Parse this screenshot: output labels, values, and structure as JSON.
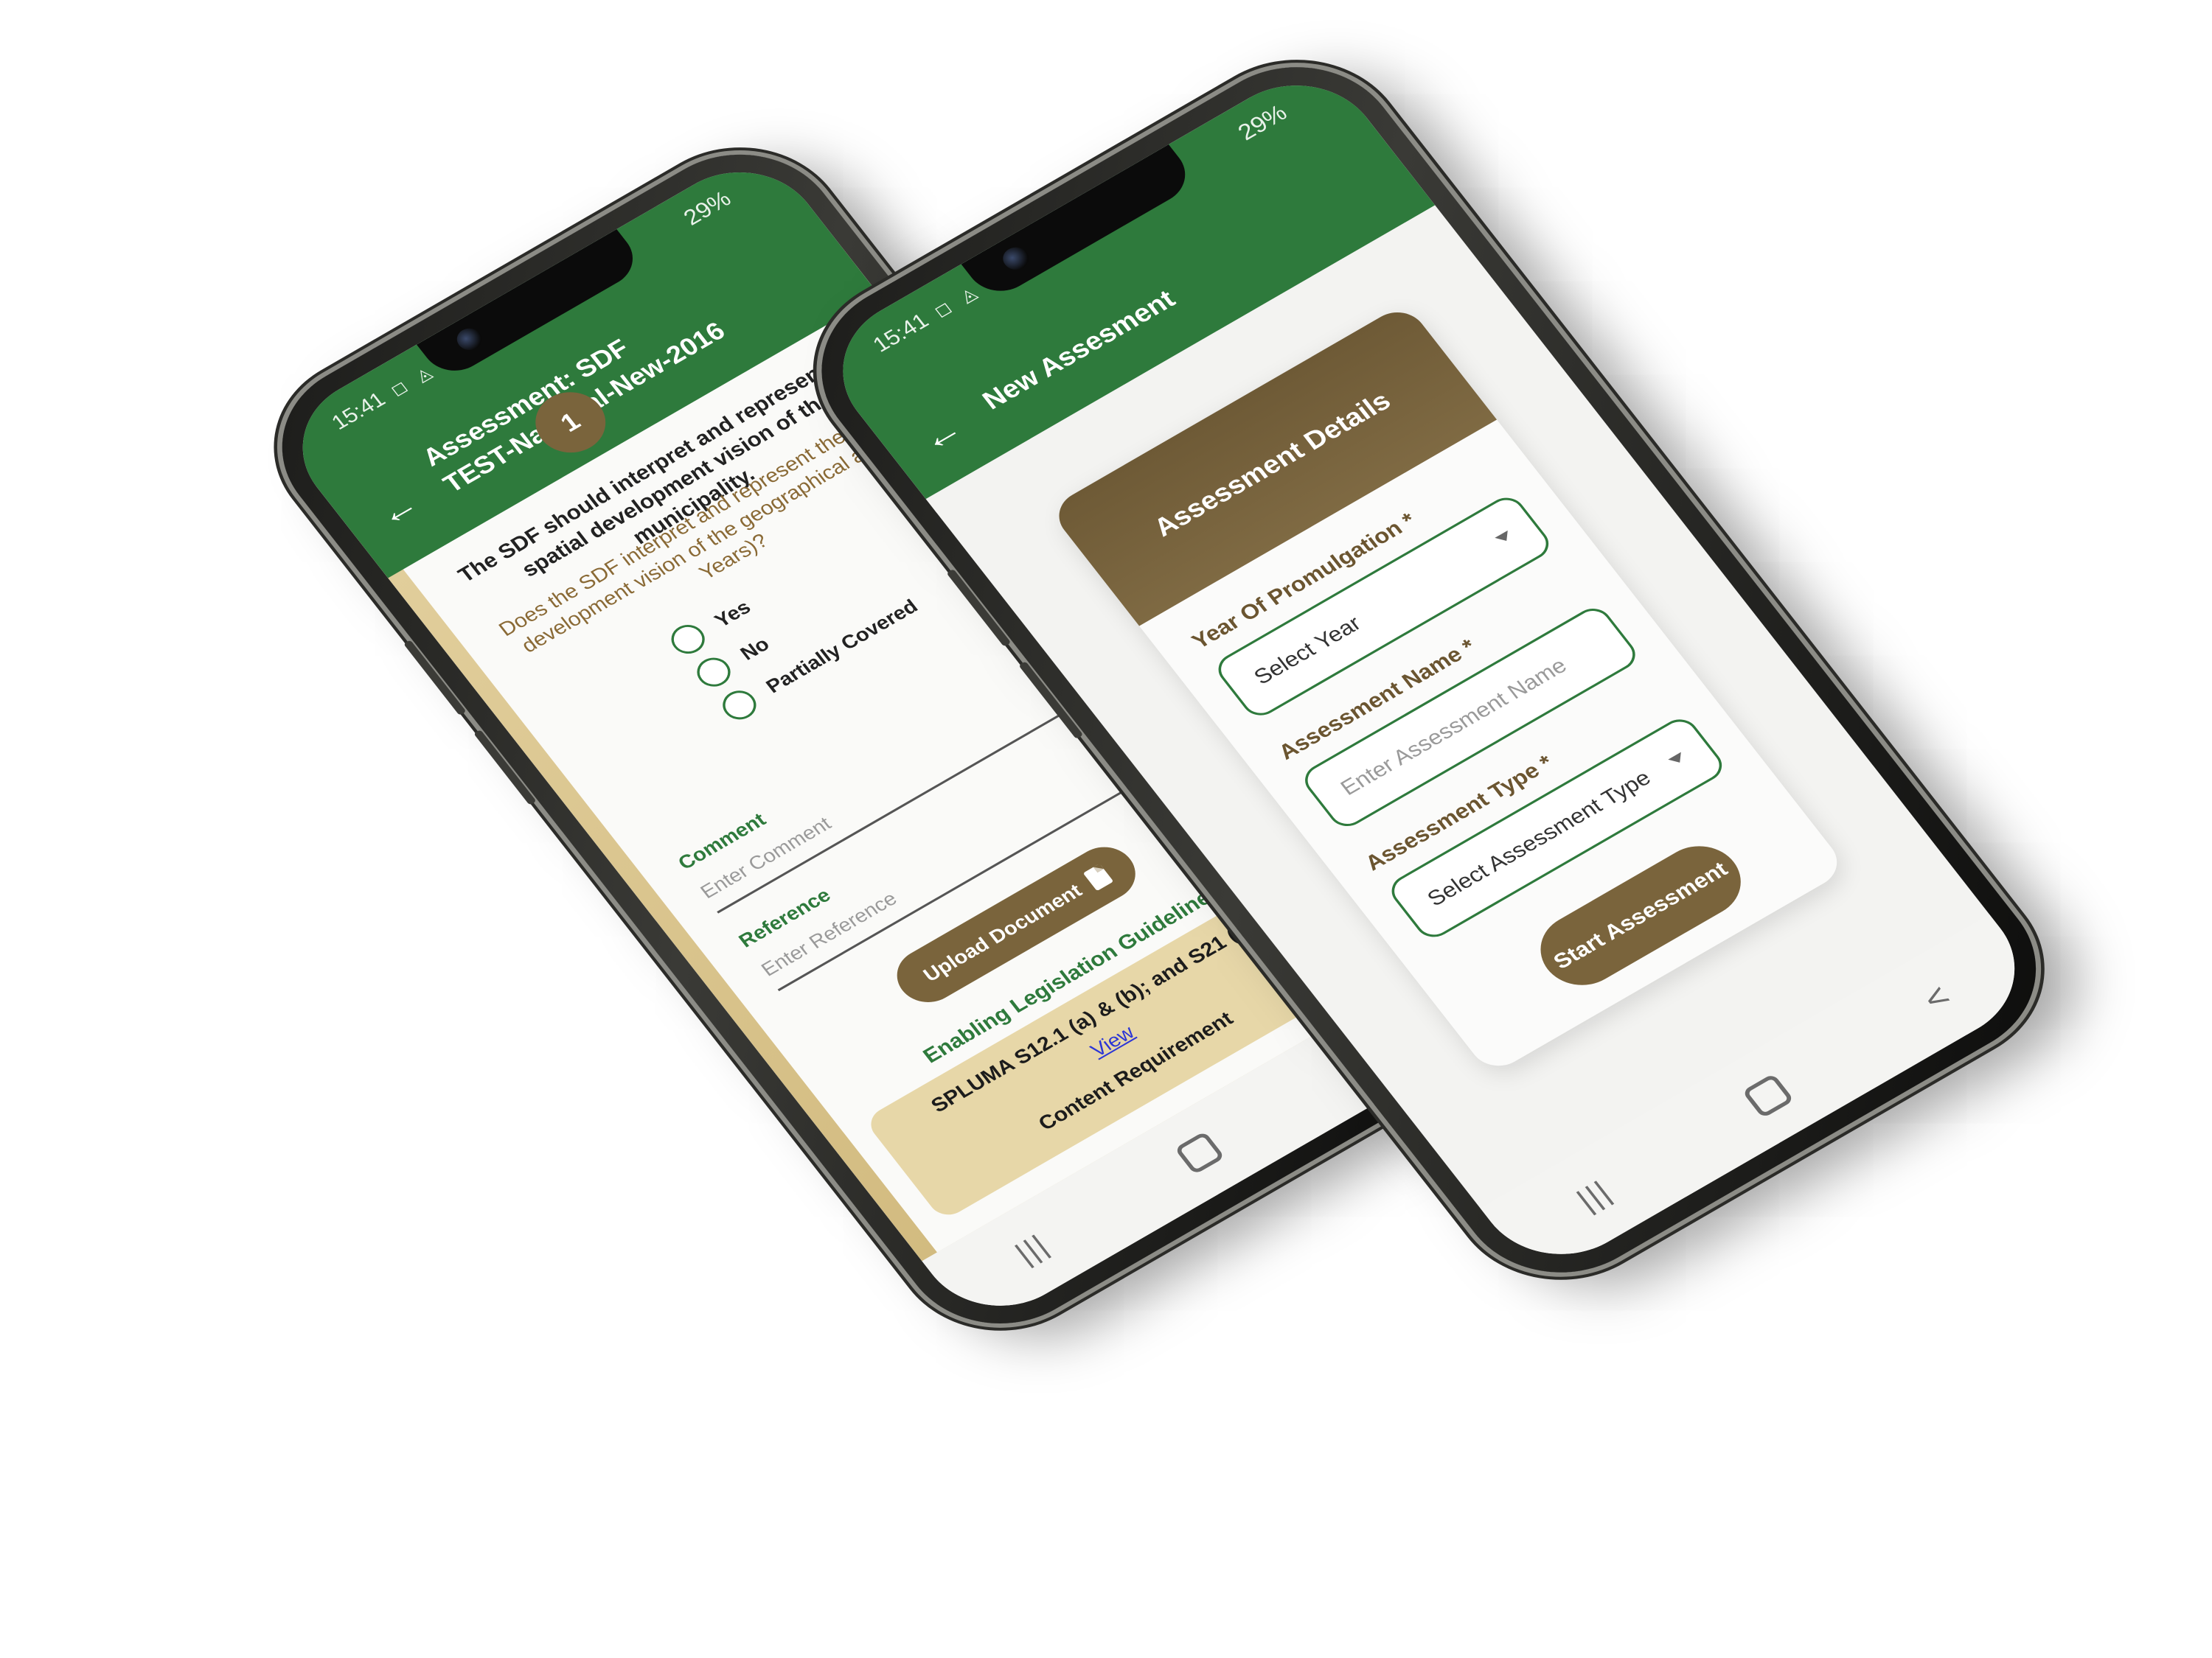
{
  "left_phone": {
    "status": {
      "time": "15:41",
      "battery": "29%",
      "icons": "◻ ◬ ⊙"
    },
    "app_bar": {
      "back_icon": "arrow-left-icon",
      "title_line1": "Assessment: SDF",
      "title_line2": "TEST-National-New-2016"
    },
    "question": {
      "number": "1",
      "title": "The SDF should interpret and represent the spatial development vision of the municipality.",
      "subtitle": "Does the SDF interpret and represent the spatial development vision of the geographical area (5 Years)?",
      "options": [
        "Yes",
        "No",
        "Partially Covered"
      ]
    },
    "comment": {
      "label": "Comment",
      "placeholder": "Enter Comment"
    },
    "reference": {
      "label": "Reference",
      "placeholder": "Enter Reference"
    },
    "upload_button": "Upload Document",
    "legislation": {
      "title": "Enabling Legislation Guideline",
      "text": "SPLUMA S12.1 (a) & (b); and S21 (c)",
      "link": "View",
      "requirement": "Content Requirement"
    },
    "nav": {
      "recents": "|||",
      "back": "<"
    }
  },
  "right_phone": {
    "status": {
      "time": "15:41",
      "battery": "29%",
      "icons": "◻ ◬ ⊙"
    },
    "app_bar": {
      "back_icon": "arrow-left-icon",
      "title": "New Assesment"
    },
    "card_title": "Assessment Details",
    "year": {
      "label": "Year Of Promulgation *",
      "value": "Select Year"
    },
    "name": {
      "label": "Assessment Name *",
      "placeholder": "Enter Assessment Name"
    },
    "type": {
      "label": "Assessment Type *",
      "value": "Select Assessment Type"
    },
    "start_button": "Start Assessment",
    "nav": {
      "recents": "|||",
      "back": "<"
    }
  },
  "colors": {
    "green": "#2e7a3c",
    "brown": "#7a643c",
    "gold": "#e2cf9d"
  }
}
